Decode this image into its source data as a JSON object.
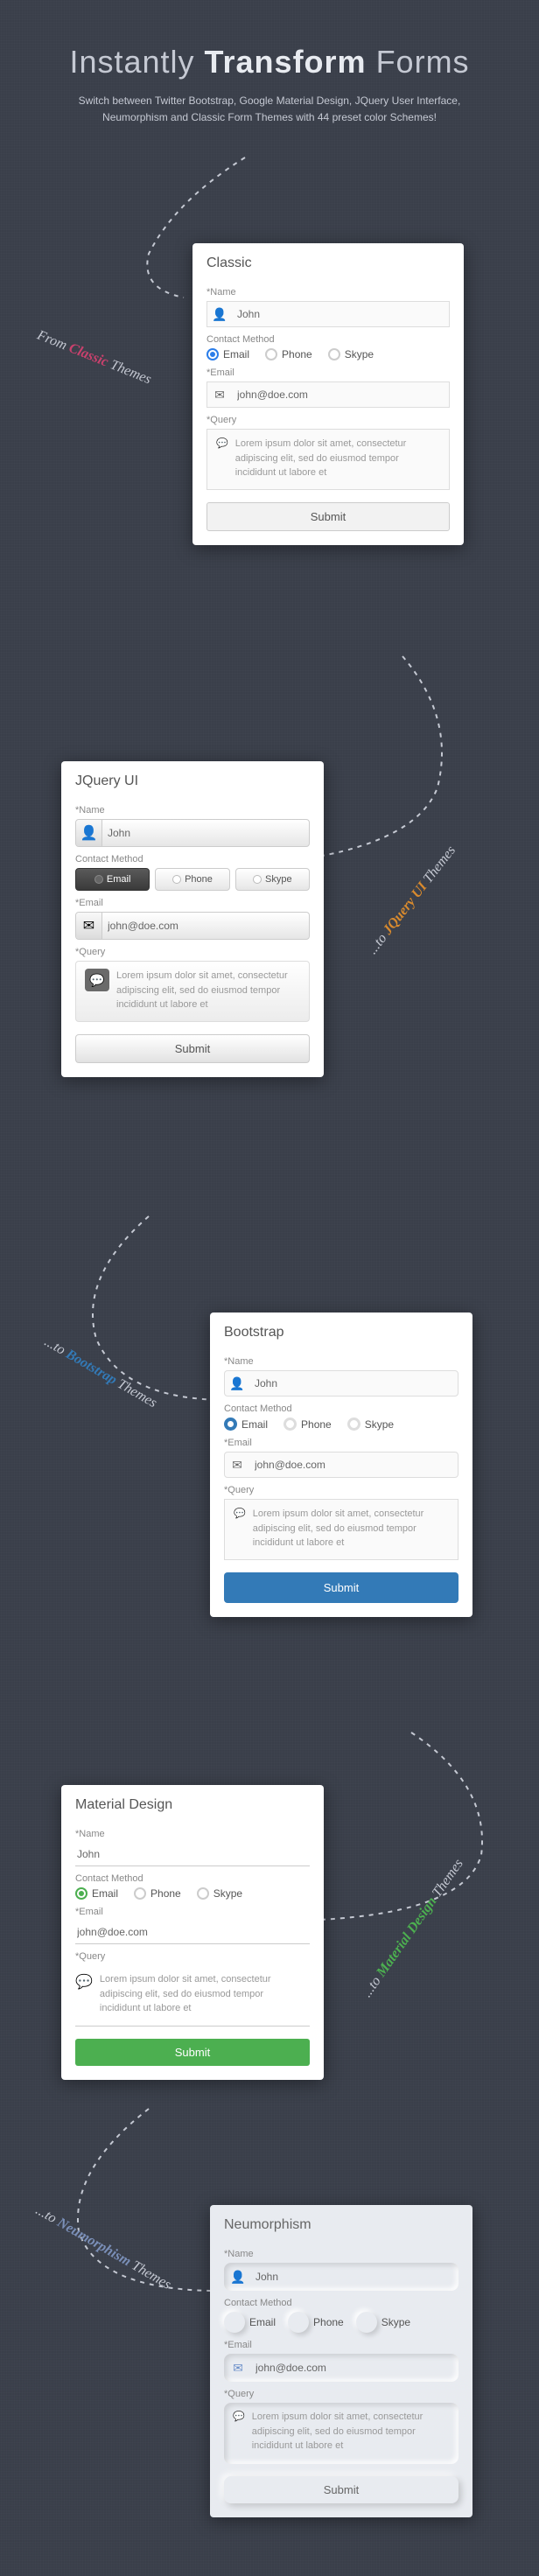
{
  "hero": {
    "title_pre": "Instantly ",
    "title_bold": "Transform",
    "title_post": " Forms",
    "subtitle": "Switch between Twitter Bootstrap, Google Material Design, JQuery User Interface, Neumorphism and Classic Form Themes with 44 preset color Schemes!"
  },
  "tags": {
    "t1_pre": "From ",
    "t1_accent": "Classic",
    "t1_post": " Themes",
    "t2_pre": "...to ",
    "t2_accent": "JQuery UI",
    "t2_post": " Themes",
    "t3_pre": "...to ",
    "t3_accent": "Bootstrap",
    "t3_post": " Themes",
    "t4_pre": "...to ",
    "t4_accent": "Material Design",
    "t4_post": " Themes",
    "t5_pre": "...to ",
    "t5_accent": "Neumorphism",
    "t5_post": " Themes"
  },
  "colors": {
    "classic": "#c9416d",
    "jquery": "#d88a2e",
    "bootstrap": "#337ab7",
    "material": "#4caf50",
    "neumorph": "#7a8fb8"
  },
  "form": {
    "labels": {
      "name": "*Name",
      "contact": "Contact Method",
      "email": "*Email",
      "query": "*Query"
    },
    "values": {
      "name": "John",
      "email": "john@doe.com",
      "query": "Lorem ipsum dolor sit amet, consectetur adipiscing elit, sed do eiusmod tempor incididunt ut labore et"
    },
    "radios": {
      "email": "Email",
      "phone": "Phone",
      "skype": "Skype"
    },
    "submit": "Submit"
  },
  "cards": {
    "classic": "Classic",
    "jquery": "JQuery UI",
    "bootstrap": "Bootstrap",
    "material": "Material Design",
    "neumorph": "Neumorphism"
  }
}
